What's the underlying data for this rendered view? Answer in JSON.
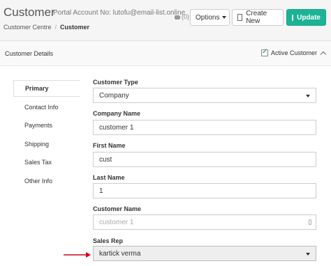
{
  "header": {
    "title": "Customer",
    "portal_account": "Portal Account No: lutofu@email-list.online",
    "comments_count": "(0)",
    "options_label": "Options",
    "create_new_label": "Create New",
    "update_label": "Update",
    "accent_color": "#1bb394"
  },
  "breadcrumb": {
    "root": "Customer Centre",
    "separator": "/",
    "current": "Customer"
  },
  "panel": {
    "title": "Customer Details",
    "active_label": "Active Customer",
    "active_checked": true
  },
  "tabs": [
    {
      "label": "Primary",
      "active": true
    },
    {
      "label": "Contact Info",
      "active": false
    },
    {
      "label": "Payments",
      "active": false
    },
    {
      "label": "Shipping",
      "active": false
    },
    {
      "label": "Sales Tax",
      "active": false
    },
    {
      "label": "Other Info",
      "active": false
    }
  ],
  "form": {
    "customer_type": {
      "label": "Customer Type",
      "value": "Company"
    },
    "company_name": {
      "label": "Company Name",
      "value": "customer 1"
    },
    "first_name": {
      "label": "First Name",
      "value": "cust"
    },
    "last_name": {
      "label": "Last Name",
      "value": "1"
    },
    "customer_name": {
      "label": "Customer Name",
      "placeholder": "customer 1"
    },
    "sales_rep": {
      "label": "Sales Rep",
      "value": "kartick verma"
    }
  }
}
